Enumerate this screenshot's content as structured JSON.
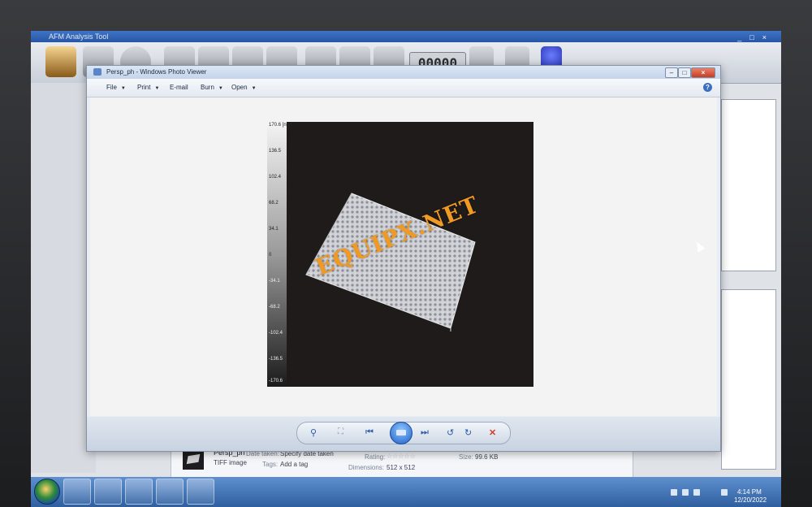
{
  "bg_app": {
    "title": "AFM Analysis Tool",
    "counter": "00000"
  },
  "viewer": {
    "title": "Persp_ph - Windows Photo Viewer",
    "menu": [
      {
        "label": "File"
      },
      {
        "label": "Print"
      },
      {
        "label": "E-mail"
      },
      {
        "label": "Burn"
      },
      {
        "label": "Open"
      }
    ],
    "help": "?",
    "image": {
      "scale_labels": [
        "170.6 [nm]",
        "136.5",
        "102.4",
        "68.2",
        "34.1",
        "0",
        "-34.1",
        "-68.2",
        "-102.4",
        "-136.5",
        "-170.6"
      ],
      "watermark": "EQUIPX.NET"
    }
  },
  "info": {
    "filename": "Persp_ph",
    "filetype": "TIFF image",
    "date_label": "Date taken:",
    "date_value": "Specify date taken",
    "tags_label": "Tags:",
    "tags_value": "Add a tag",
    "rating_label": "Rating:",
    "rating_stars": "☆☆☆☆☆",
    "dimensions_label": "Dimensions:",
    "dimensions_value": "512 x 512",
    "size_label": "Size:",
    "size_value": "99.6 KB"
  },
  "taskbar": {
    "time": "4:14 PM",
    "date": "12/20/2022"
  }
}
